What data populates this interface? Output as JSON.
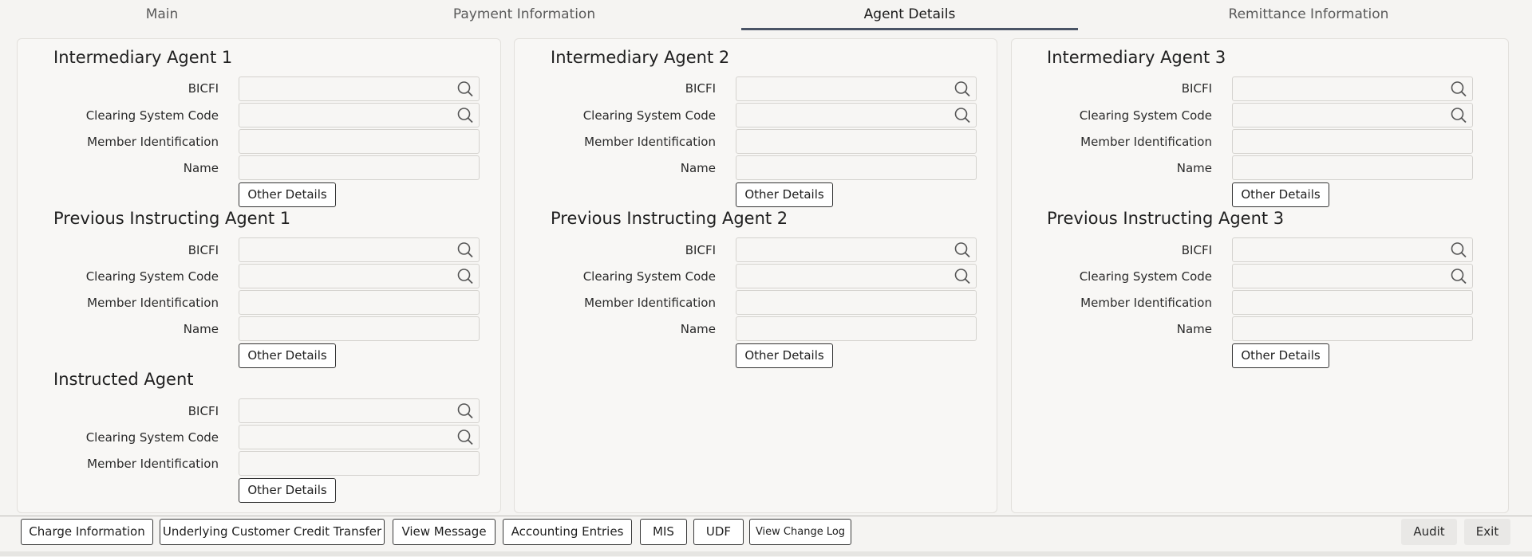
{
  "tabs": [
    {
      "label": "Main",
      "active": false
    },
    {
      "label": "Payment Information",
      "active": false
    },
    {
      "label": "Agent Details",
      "active": true
    },
    {
      "label": "Remittance Information",
      "active": false
    }
  ],
  "sections": {
    "intermediary_agent_1": {
      "title": "Intermediary Agent 1",
      "bicfi": "BICFI",
      "clearing": "Clearing System Code",
      "member": "Member Identification",
      "name": "Name",
      "other": "Other Details"
    },
    "intermediary_agent_2": {
      "title": "Intermediary Agent 2",
      "bicfi": "BICFI",
      "clearing": "Clearing System Code",
      "member": "Member Identification",
      "name": "Name",
      "other": "Other Details"
    },
    "intermediary_agent_3": {
      "title": "Intermediary Agent 3",
      "bicfi": "BICFI",
      "clearing": "Clearing System Code",
      "member": "Member Identification",
      "name": "Name",
      "other": "Other Details"
    },
    "previous_instructing_agent_1": {
      "title": "Previous Instructing Agent 1",
      "bicfi": "BICFI",
      "clearing": "Clearing System Code",
      "member": "Member Identification",
      "name": "Name",
      "other": "Other Details"
    },
    "previous_instructing_agent_2": {
      "title": "Previous Instructing Agent 2",
      "bicfi": "BICFI",
      "clearing": "Clearing System Code",
      "member": "Member Identification",
      "name": "Name",
      "other": "Other Details"
    },
    "previous_instructing_agent_3": {
      "title": "Previous Instructing Agent 3",
      "bicfi": "BICFI",
      "clearing": "Clearing System Code",
      "member": "Member Identification",
      "name": "Name",
      "other": "Other Details"
    },
    "instructed_agent": {
      "title": "Instructed Agent",
      "bicfi": "BICFI",
      "clearing": "Clearing System Code",
      "member": "Member Identification",
      "other": "Other Details"
    }
  },
  "footer": {
    "charge_information": "Charge Information",
    "underlying_customer_credit_transfer": "Underlying Customer Credit Transfer",
    "view_message": "View Message",
    "accounting_entries": "Accounting Entries",
    "mis": "MIS",
    "udf": "UDF",
    "view_change_log": "View Change Log",
    "audit": "Audit",
    "exit": "Exit"
  },
  "icons": {
    "lookup": "search-icon"
  },
  "colors": {
    "active_tab_underline": "#4a5466",
    "background": "#f5f4f2"
  }
}
